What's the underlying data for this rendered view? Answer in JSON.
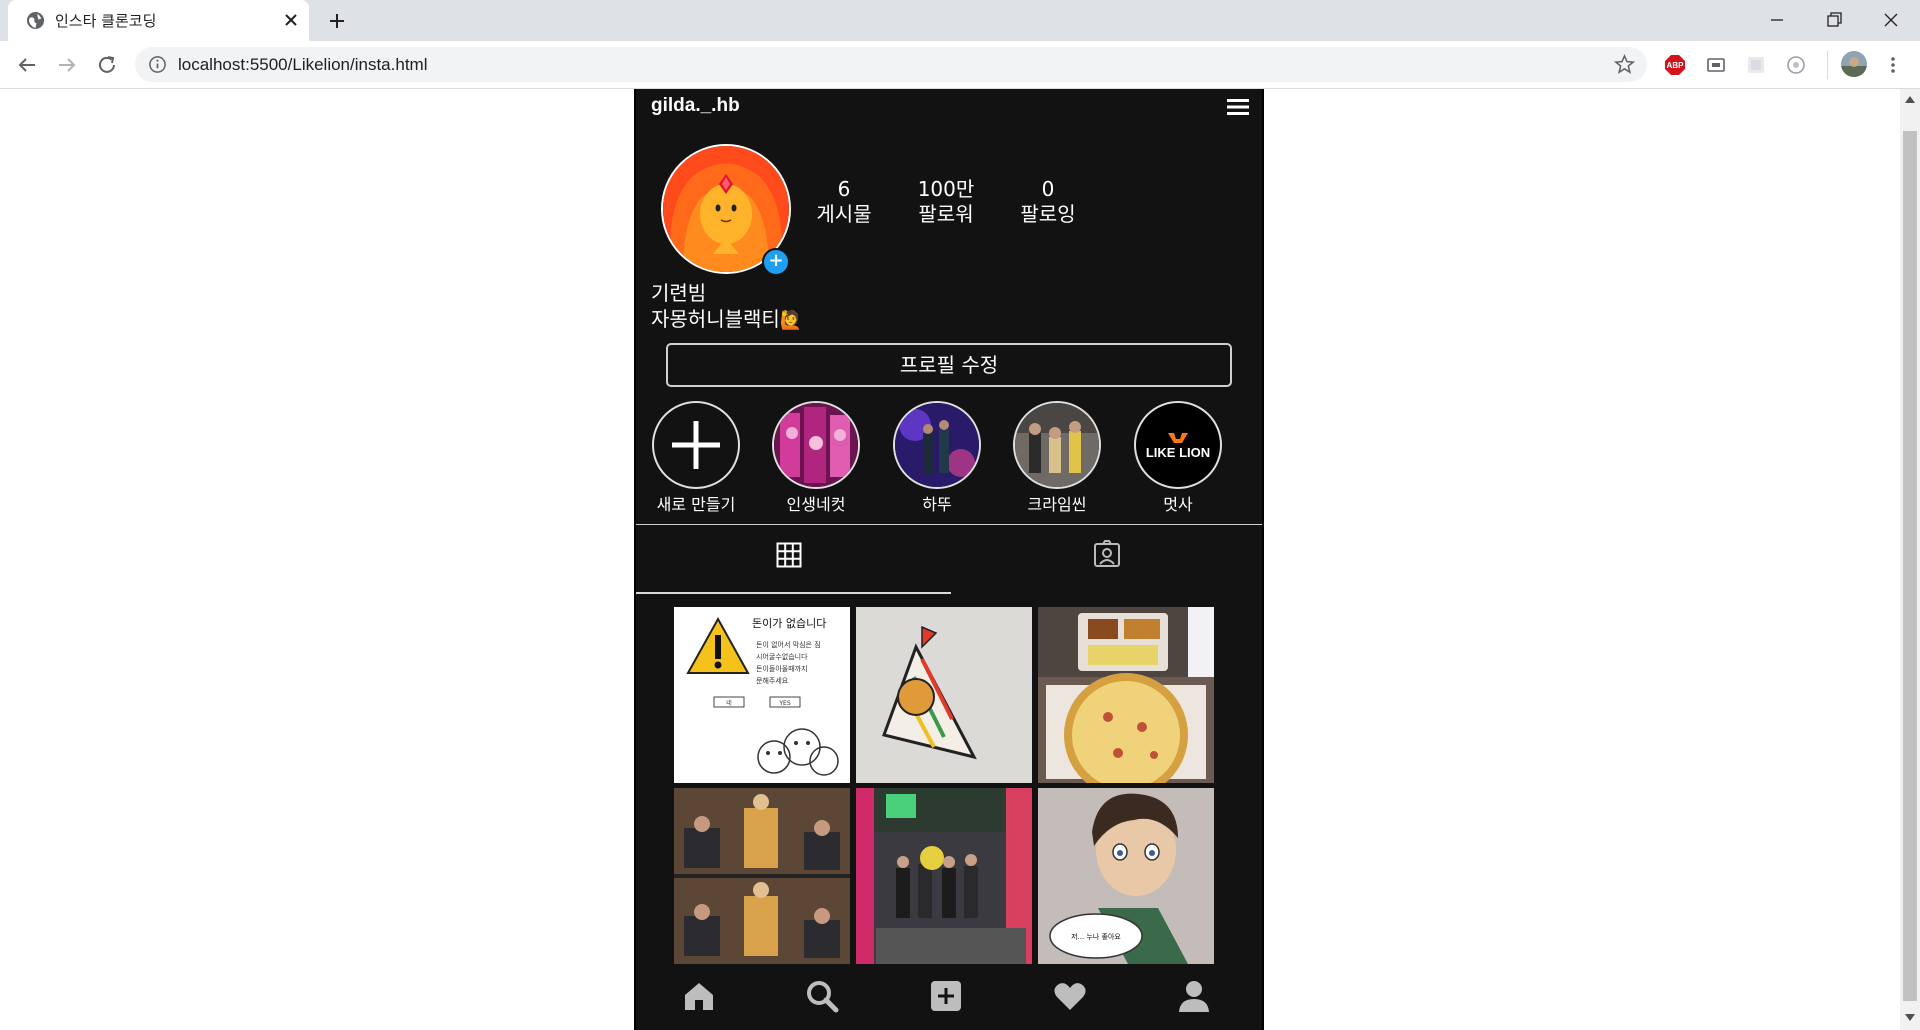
{
  "browser": {
    "tab_title": "인스타 클론코딩",
    "url": "localhost:5500/Likelion/insta.html",
    "extensions": [
      "abp-icon",
      "cast-icon",
      "extension-icon",
      "circle-icon"
    ]
  },
  "profile": {
    "username": "gilda._.hb",
    "stats": [
      {
        "value": "6",
        "label": "게시물"
      },
      {
        "value": "100만",
        "label": "팔로워"
      },
      {
        "value": "0",
        "label": "팔로잉"
      }
    ],
    "name": "기련빔",
    "bio": "자몽허니블랙티",
    "bio_emoji": "🙋",
    "edit_button": "프로필 수정"
  },
  "highlights": [
    {
      "label": "새로 만들기"
    },
    {
      "label": "인생네컷"
    },
    {
      "label": "하뚜"
    },
    {
      "label": "크라임씬"
    },
    {
      "label": "멋사"
    }
  ],
  "highlight_logo_text": "LIKE LION",
  "posts": [
    {
      "caption": "돈이가 없습니다",
      "lines": [
        "돈이 없어서 막심은 짐",
        "시어굴수없습니다",
        "돈이돌아올때까지",
        "문해주세요"
      ],
      "buttons": [
        "네",
        "YES"
      ]
    },
    {
      "caption": ""
    },
    {
      "caption": ""
    },
    {
      "caption": ""
    },
    {
      "caption": ""
    },
    {
      "caption": "저... 누나 좋아요"
    }
  ],
  "colors": {
    "page_bg": "#121212",
    "accent_blue": "#1e9ff2",
    "text": "#ffffff"
  }
}
